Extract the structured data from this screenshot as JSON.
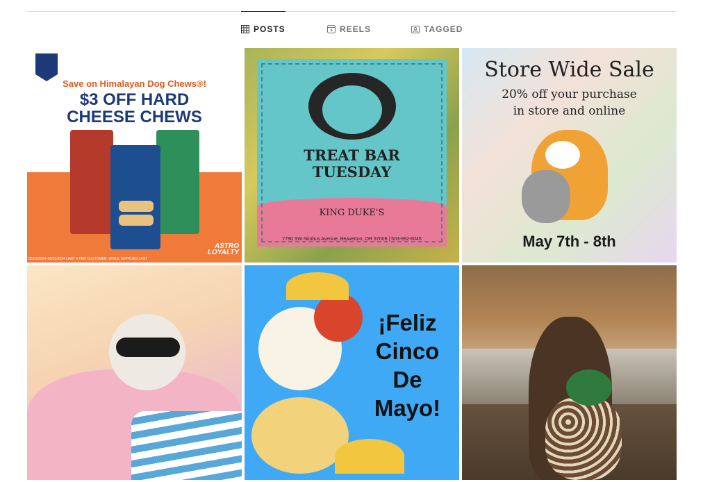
{
  "tabs": [
    {
      "label": "POSTS",
      "icon": "grid-icon",
      "active": true
    },
    {
      "label": "REELS",
      "icon": "reels-icon",
      "active": false
    },
    {
      "label": "TAGGED",
      "icon": "tagged-icon",
      "active": false
    }
  ],
  "posts": [
    {
      "save_line": "Save on Himalayan Dog Chews®!",
      "headline_1": "$3 OFF HARD",
      "headline_2": "CHEESE CHEWS",
      "brand": "ASTRO LOYALTY",
      "fine_print": "05/01/2024–05/31/2024 LIMIT 4 PER CUSTOMER. WHILE SUPPLIES LAST"
    },
    {
      "line_1": "TREAT BAR",
      "line_2": "TUESDAY",
      "store": "KING DUKE'S",
      "address": "7790 SW Nimbus Avenue, Beaverton, OR 97008 | 503-992-6045"
    },
    {
      "line_1": "Store Wide Sale",
      "line_2": "20% off your purchase",
      "line_3": "in store and online",
      "dates": "May 7th - 8th"
    },
    {
      "caption": ""
    },
    {
      "line_1": "¡Feliz",
      "line_2": "Cinco",
      "line_3": "De",
      "line_4": "Mayo!"
    },
    {
      "caption": ""
    }
  ],
  "colors": {
    "accent_orange": "#f07a3a",
    "teal": "#64c6c8",
    "pink": "#e87a98",
    "sky": "#3fa9f5"
  }
}
